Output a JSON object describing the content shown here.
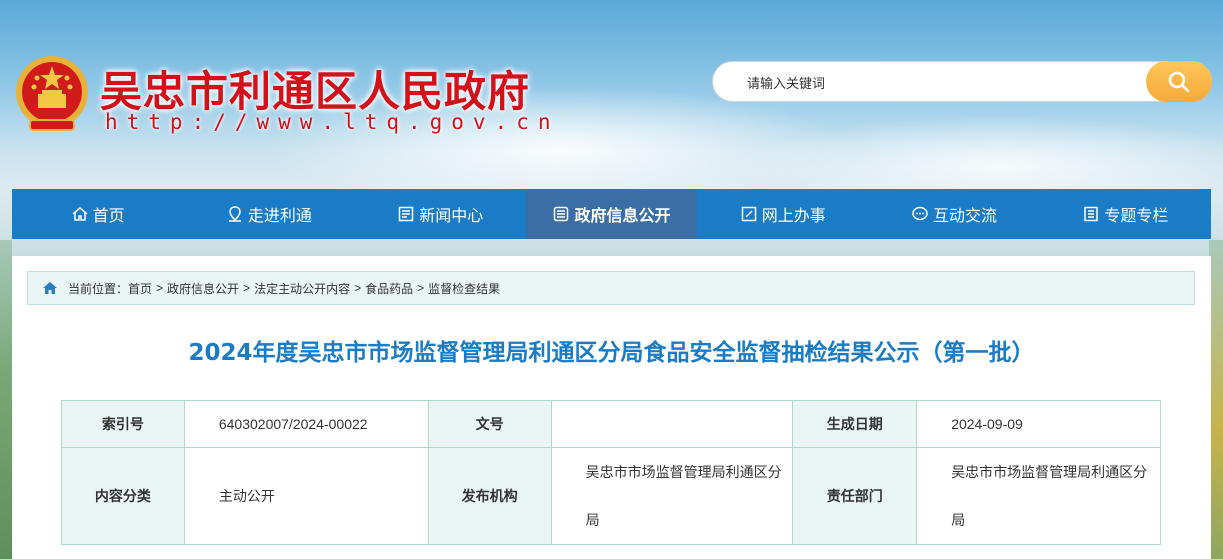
{
  "header": {
    "site_title": "吴忠市利通区人民政府",
    "site_url": "http://www.ltq.gov.cn",
    "search_placeholder": "请输入关键词"
  },
  "nav": {
    "items": [
      {
        "label": "首页",
        "icon": "home-icon"
      },
      {
        "label": "走进利通",
        "icon": "location-pin-icon"
      },
      {
        "label": "新闻中心",
        "icon": "news-icon"
      },
      {
        "label": "政府信息公开",
        "icon": "document-icon",
        "active": true
      },
      {
        "label": "网上办事",
        "icon": "edit-icon"
      },
      {
        "label": "互动交流",
        "icon": "chat-icon"
      },
      {
        "label": "专题专栏",
        "icon": "list-icon"
      }
    ]
  },
  "breadcrumb": {
    "prefix": "当前位置：",
    "items": [
      "首页",
      "政府信息公开",
      "法定主动公开内容",
      "食品药品",
      "监督检查结果"
    ],
    "separator": ">"
  },
  "article": {
    "title": "2024年度吴忠市市场监督管理局利通区分局食品安全监督抽检结果公示（第一批）"
  },
  "meta": {
    "index_label": "索引号",
    "index_value": "640302007/2024-00022",
    "doc_no_label": "文号",
    "doc_no_value": "",
    "date_label": "生成日期",
    "date_value": "2024-09-09",
    "category_label": "内容分类",
    "category_value": "主动公开",
    "publisher_label": "发布机构",
    "publisher_value": "吴忠市市场监督管理局利通区分局",
    "dept_label": "责任部门",
    "dept_value": "吴忠市市场监督管理局利通区分局"
  },
  "colors": {
    "brand_red": "#d3111a",
    "nav_blue": "#1a7cc6",
    "nav_active": "#3a6ea5",
    "search_button": "#f6a93a"
  }
}
